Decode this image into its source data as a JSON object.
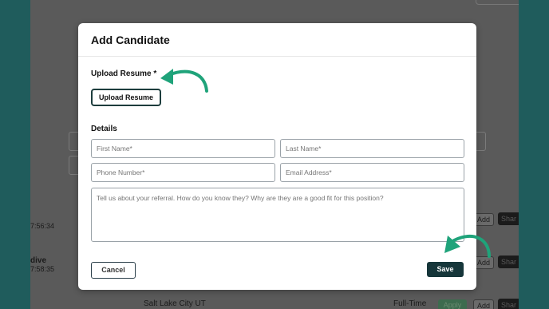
{
  "background": {
    "time_1": "7:56:34",
    "status_word": "dive",
    "time_2": "7:58:35",
    "location": "Salt Lake City UT",
    "job_type": "Full-Time",
    "add_label": "Add",
    "share_label": "Shar",
    "apply_label": "Apply"
  },
  "modal": {
    "title": "Add Candidate",
    "upload_section_label": "Upload Resume *",
    "upload_button_label": "Upload Resume",
    "details_label": "Details",
    "fields": {
      "first_name_placeholder": "First Name*",
      "last_name_placeholder": "Last Name*",
      "phone_placeholder": "Phone Number*",
      "email_placeholder": "Email Address*",
      "referral_placeholder": "Tell us about your referral. How do you know they? Why are they are a good fit for this position?"
    },
    "cancel_label": "Cancel",
    "save_label": "Save"
  },
  "colors": {
    "accent_arrow": "#1fa37a",
    "save_button": "#16363a",
    "side_band": "#1f5c5c"
  },
  "icons": {
    "arrow_1": "curved-arrow-icon",
    "arrow_2": "curved-arrow-icon"
  }
}
